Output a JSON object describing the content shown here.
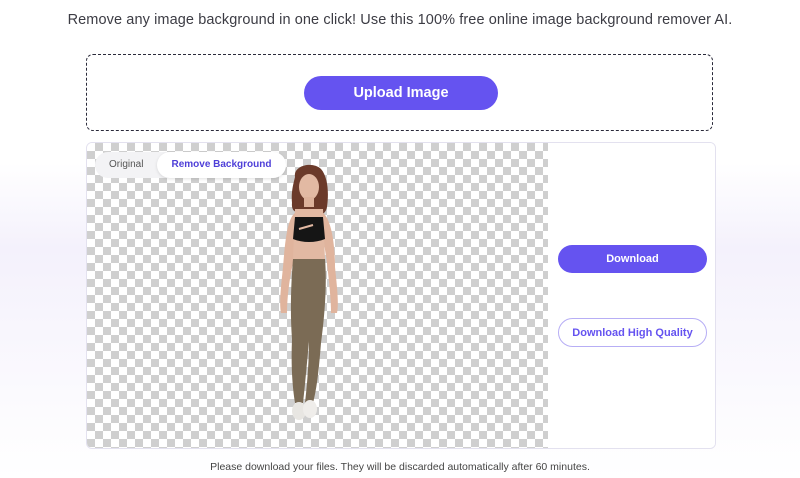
{
  "header": {
    "tagline": "Remove any image background in one click! Use this 100% free online image background remover AI."
  },
  "upload": {
    "button_label": "Upload Image"
  },
  "preview": {
    "toggle": {
      "original_label": "Original",
      "removed_label": "Remove Background",
      "selected": "Remove Background"
    }
  },
  "actions": {
    "download_label": "Download",
    "download_hq_label": "Download High Quality"
  },
  "footer": {
    "notice": "Please download your files. They will be discarded automatically after 60 minutes."
  },
  "colors": {
    "accent": "#6553f0",
    "checker": "#cfcfcf"
  }
}
